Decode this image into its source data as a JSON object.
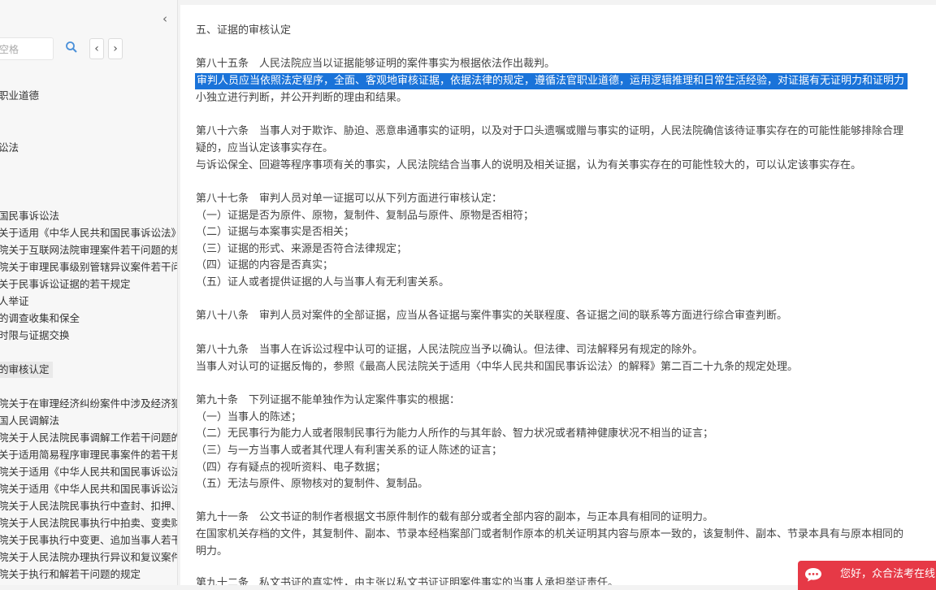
{
  "sidebar": {
    "search_placeholder": "空格",
    "collapse_icon": "‹",
    "prev_icon": "‹",
    "next_icon": "›",
    "items": [
      "职业道德",
      "讼法",
      "国民事诉讼法",
      "关于适用《中华人民共和国民事诉讼法》的",
      "院关于互联网法院审理案件若干问题的规",
      "院关于审理民事级别管辖异议案件若干问",
      "关于民事诉讼证据的若干规定",
      "人举证",
      "的调查收集和保全",
      "时限与证据交换",
      "",
      "的审核认定",
      "",
      "院关于在审理经济纠纷案件中涉及经济犯",
      "国人民调解法",
      "院关于人民法院民事调解工作若干问题的",
      "关于适用简易程序审理民事案件的若干规",
      "院关于适用《中华人民共和国民事诉讼法",
      "院关于适用《中华人民共和国民事诉讼法",
      "院关于人民法院民事执行中查封、扣押、",
      "院关于人民法院民事执行中拍卖、变卖财",
      "院关于民事执行中变更、追加当事人若干",
      "院关于人民法院办理执行异议和复议案件",
      "院关于执行和解若干问题的规定"
    ]
  },
  "content": {
    "section_title": "五、证据的审核认定",
    "lines": [
      "第八十五条　人民法院应当以证据能够证明的案件事实为根据依法作出裁判。",
      "审判人员应当依照法定程序，全面、客观地审核证据，依据法律的规定，遵循法官职业道德，运用逻辑推理和日常生活经验，对证据有无证明力和证明力",
      "小独立进行判断，并公开判断的理由和结果。",
      "第八十六条　当事人对于欺诈、胁迫、恶意串通事实的证明，以及对于口头遗嘱或赠与事实的证明，人民法院确信该待证事实存在的可能性能够排除合理",
      "疑的，应当认定该事实存在。",
      "与诉讼保全、回避等程序事项有关的事实，人民法院结合当事人的说明及相关证据，认为有关事实存在的可能性较大的，可以认定该事实存在。",
      "第八十七条　审判人员对单一证据可以从下列方面进行审核认定：",
      "（一）证据是否为原件、原物，复制件、复制品与原件、原物是否相符；",
      "（二）证据与本案事实是否相关；",
      "（三）证据的形式、来源是否符合法律规定；",
      "（四）证据的内容是否真实；",
      "（五）证人或者提供证据的人与当事人有无利害关系。",
      "第八十八条　审判人员对案件的全部证据，应当从各证据与案件事实的关联程度、各证据之间的联系等方面进行综合审查判断。",
      "第八十九条　当事人在诉讼过程中认可的证据，人民法院应当予以确认。但法律、司法解释另有规定的除外。",
      "当事人对认可的证据反悔的，参照《最高人民法院关于适用〈中华人民共和国民事诉讼法〉的解释》第二百二十九条的规定处理。",
      "第九十条　下列证据不能单独作为认定案件事实的根据：",
      "（一）当事人的陈述；",
      "（二）无民事行为能力人或者限制民事行为能力人所作的与其年龄、智力状况或者精神健康状况不相当的证言；",
      "（三）与一方当事人或者其代理人有利害关系的证人陈述的证言；",
      "（四）存有疑点的视听资料、电子数据；",
      "（五）无法与原件、原物核对的复制件、复制品。",
      "第九十一条　公文书证的制作者根据文书原件制作的载有部分或者全部内容的副本，与正本具有相同的证明力。",
      "在国家机关存档的文件，其复制件、副本、节录本经档案部门或者制作原本的机关证明其内容与原本一致的，该复制件、副本、节录本具有与原本相同的",
      "明力。",
      "第九十二条　私文书证的真实性，由主张以私文书证证明案件事实的当事人承担举证责任。"
    ]
  },
  "chat": {
    "text": "您好，众合法考在线",
    "color": "#e63946"
  }
}
